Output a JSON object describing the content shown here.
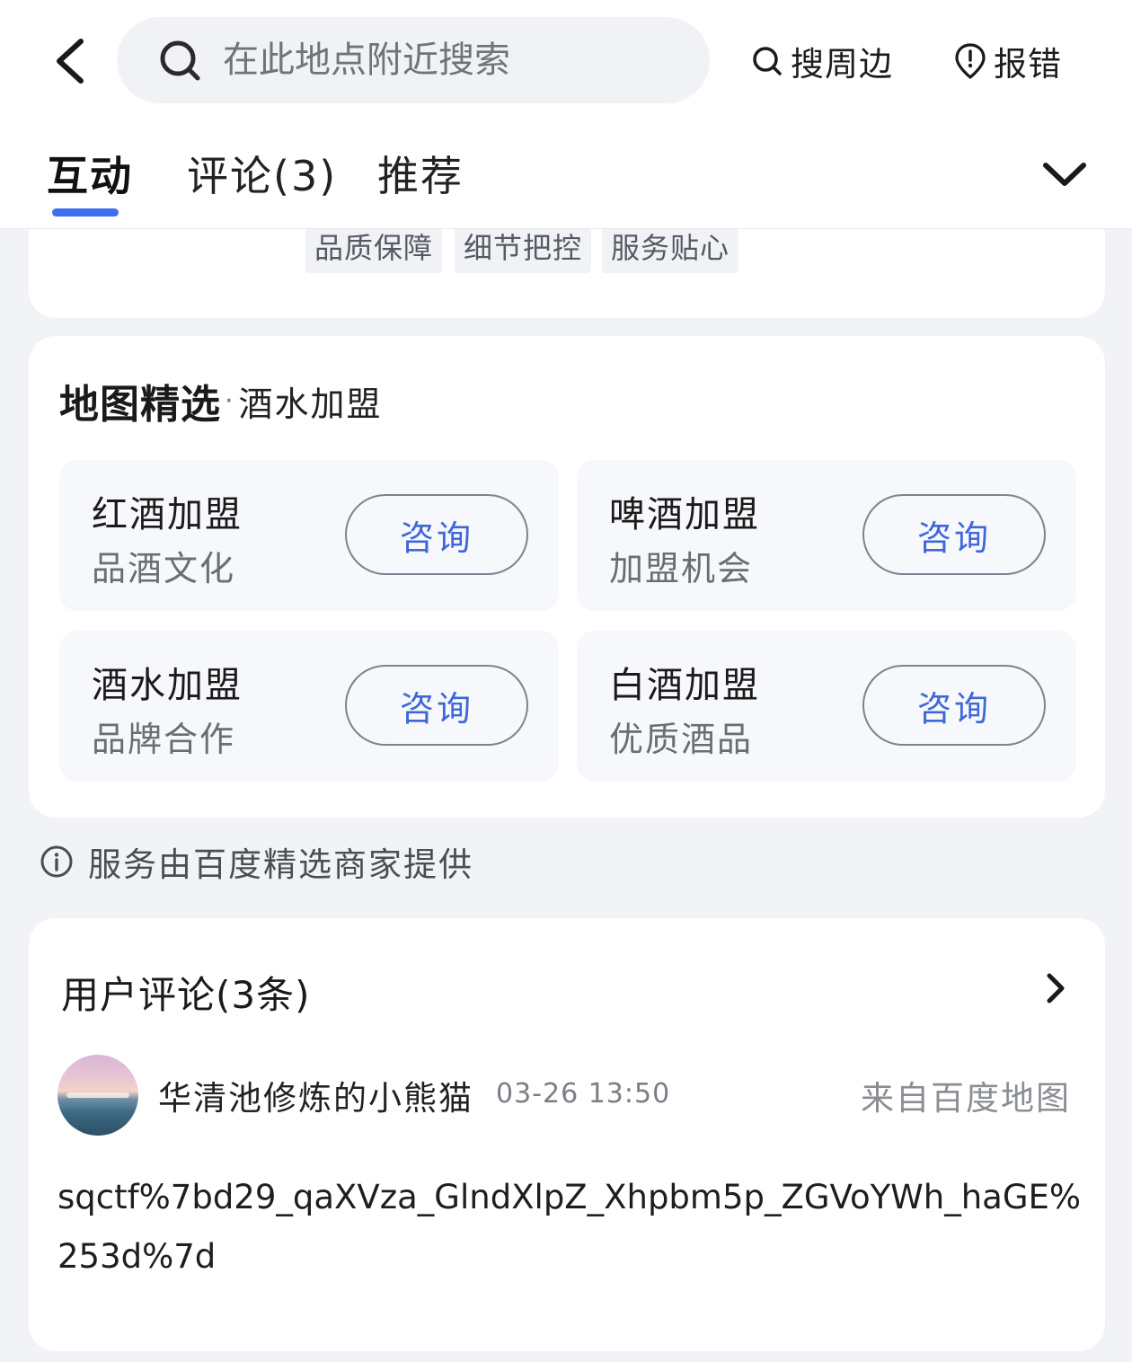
{
  "header": {
    "search_placeholder": "在此地点附近搜索",
    "nearby_label": "搜周边",
    "report_label": "报错"
  },
  "tabs": [
    {
      "label": "互动"
    },
    {
      "label": "评论(3)"
    },
    {
      "label": "推荐"
    }
  ],
  "tags": [
    "品质保障",
    "细节把控",
    "服务贴心"
  ],
  "select": {
    "brand": "地图精选",
    "separator": "·",
    "category": "酒水加盟",
    "offers": [
      {
        "title": "红酒加盟",
        "subtitle": "品酒文化",
        "button": "咨询"
      },
      {
        "title": "啤酒加盟",
        "subtitle": "加盟机会",
        "button": "咨询"
      },
      {
        "title": "酒水加盟",
        "subtitle": "品牌合作",
        "button": "咨询"
      },
      {
        "title": "白酒加盟",
        "subtitle": "优质酒品",
        "button": "咨询"
      }
    ]
  },
  "provider_note": "服务由百度精选商家提供",
  "comments": {
    "title": "用户评论(3条)",
    "items": [
      {
        "user": "华清池修炼的小熊猫",
        "time": "03-26 13:50",
        "source": "来自百度地图",
        "text": "sqctf%7bd29_qaXVza_GlndXlpZ_Xhpbm5p_ZGVoYWh_haGE%253d%7d"
      }
    ]
  },
  "colors": {
    "accent": "#3f6ef0",
    "button_text": "#3e67d8",
    "page_bg": "#f2f3f6"
  }
}
